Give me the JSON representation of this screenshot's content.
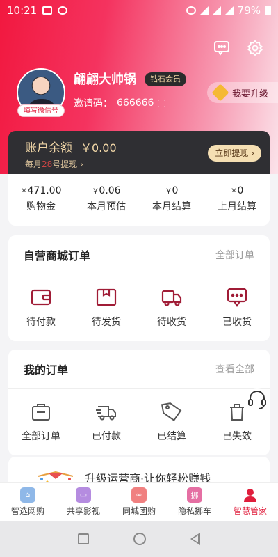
{
  "status_bar": {
    "time": "10:21",
    "battery": "79%"
  },
  "profile": {
    "name": "翩翩大帅锅",
    "member_level": "钻石会员",
    "invite_label": "邀请码：",
    "invite_code": "666666",
    "avatar_tag": "填写微信号",
    "upgrade_label": "我要升级"
  },
  "balance": {
    "title": "账户余额",
    "amount": "￥0.00",
    "sub_prefix": "每月",
    "sub_day": "28",
    "sub_suffix": "号提现",
    "withdraw_label": "立即提现"
  },
  "stats": [
    {
      "currency": "￥",
      "value": "471.00",
      "label": "购物金"
    },
    {
      "currency": "￥",
      "value": "0.06",
      "label": "本月预估"
    },
    {
      "currency": "￥",
      "value": "0",
      "label": "本月结算"
    },
    {
      "currency": "￥",
      "value": "0",
      "label": "上月结算"
    }
  ],
  "mall_orders": {
    "title": "自营商城订单",
    "link": "全部订单",
    "items": [
      {
        "label": "待付款",
        "icon": "wallet-icon"
      },
      {
        "label": "待发货",
        "icon": "package-icon"
      },
      {
        "label": "待收货",
        "icon": "truck-icon"
      },
      {
        "label": "已收货",
        "icon": "message-icon"
      }
    ]
  },
  "my_orders": {
    "title": "我的订单",
    "link": "查看全部",
    "items": [
      {
        "label": "全部订单",
        "icon": "bag-icon"
      },
      {
        "label": "已付款",
        "icon": "delivery-icon"
      },
      {
        "label": "已结算",
        "icon": "tag-icon"
      },
      {
        "label": "已失效",
        "icon": "trash-icon"
      }
    ]
  },
  "promo": {
    "text": "升级运营商·让你轻松赚钱"
  },
  "tabbar": [
    {
      "label": "智选网购",
      "color": "#8fb8e8",
      "icon": "home-icon"
    },
    {
      "label": "共享影视",
      "color": "#b58ce0",
      "icon": "tv-icon"
    },
    {
      "label": "同城团购",
      "color": "#f08080",
      "icon": "link-icon"
    },
    {
      "label": "隐私挪车",
      "color": "#e56fa3",
      "icon": "car-icon",
      "glyph": "挪"
    },
    {
      "label": "智慧管家",
      "color": "#e01e3c",
      "icon": "user-icon",
      "active": true
    }
  ]
}
